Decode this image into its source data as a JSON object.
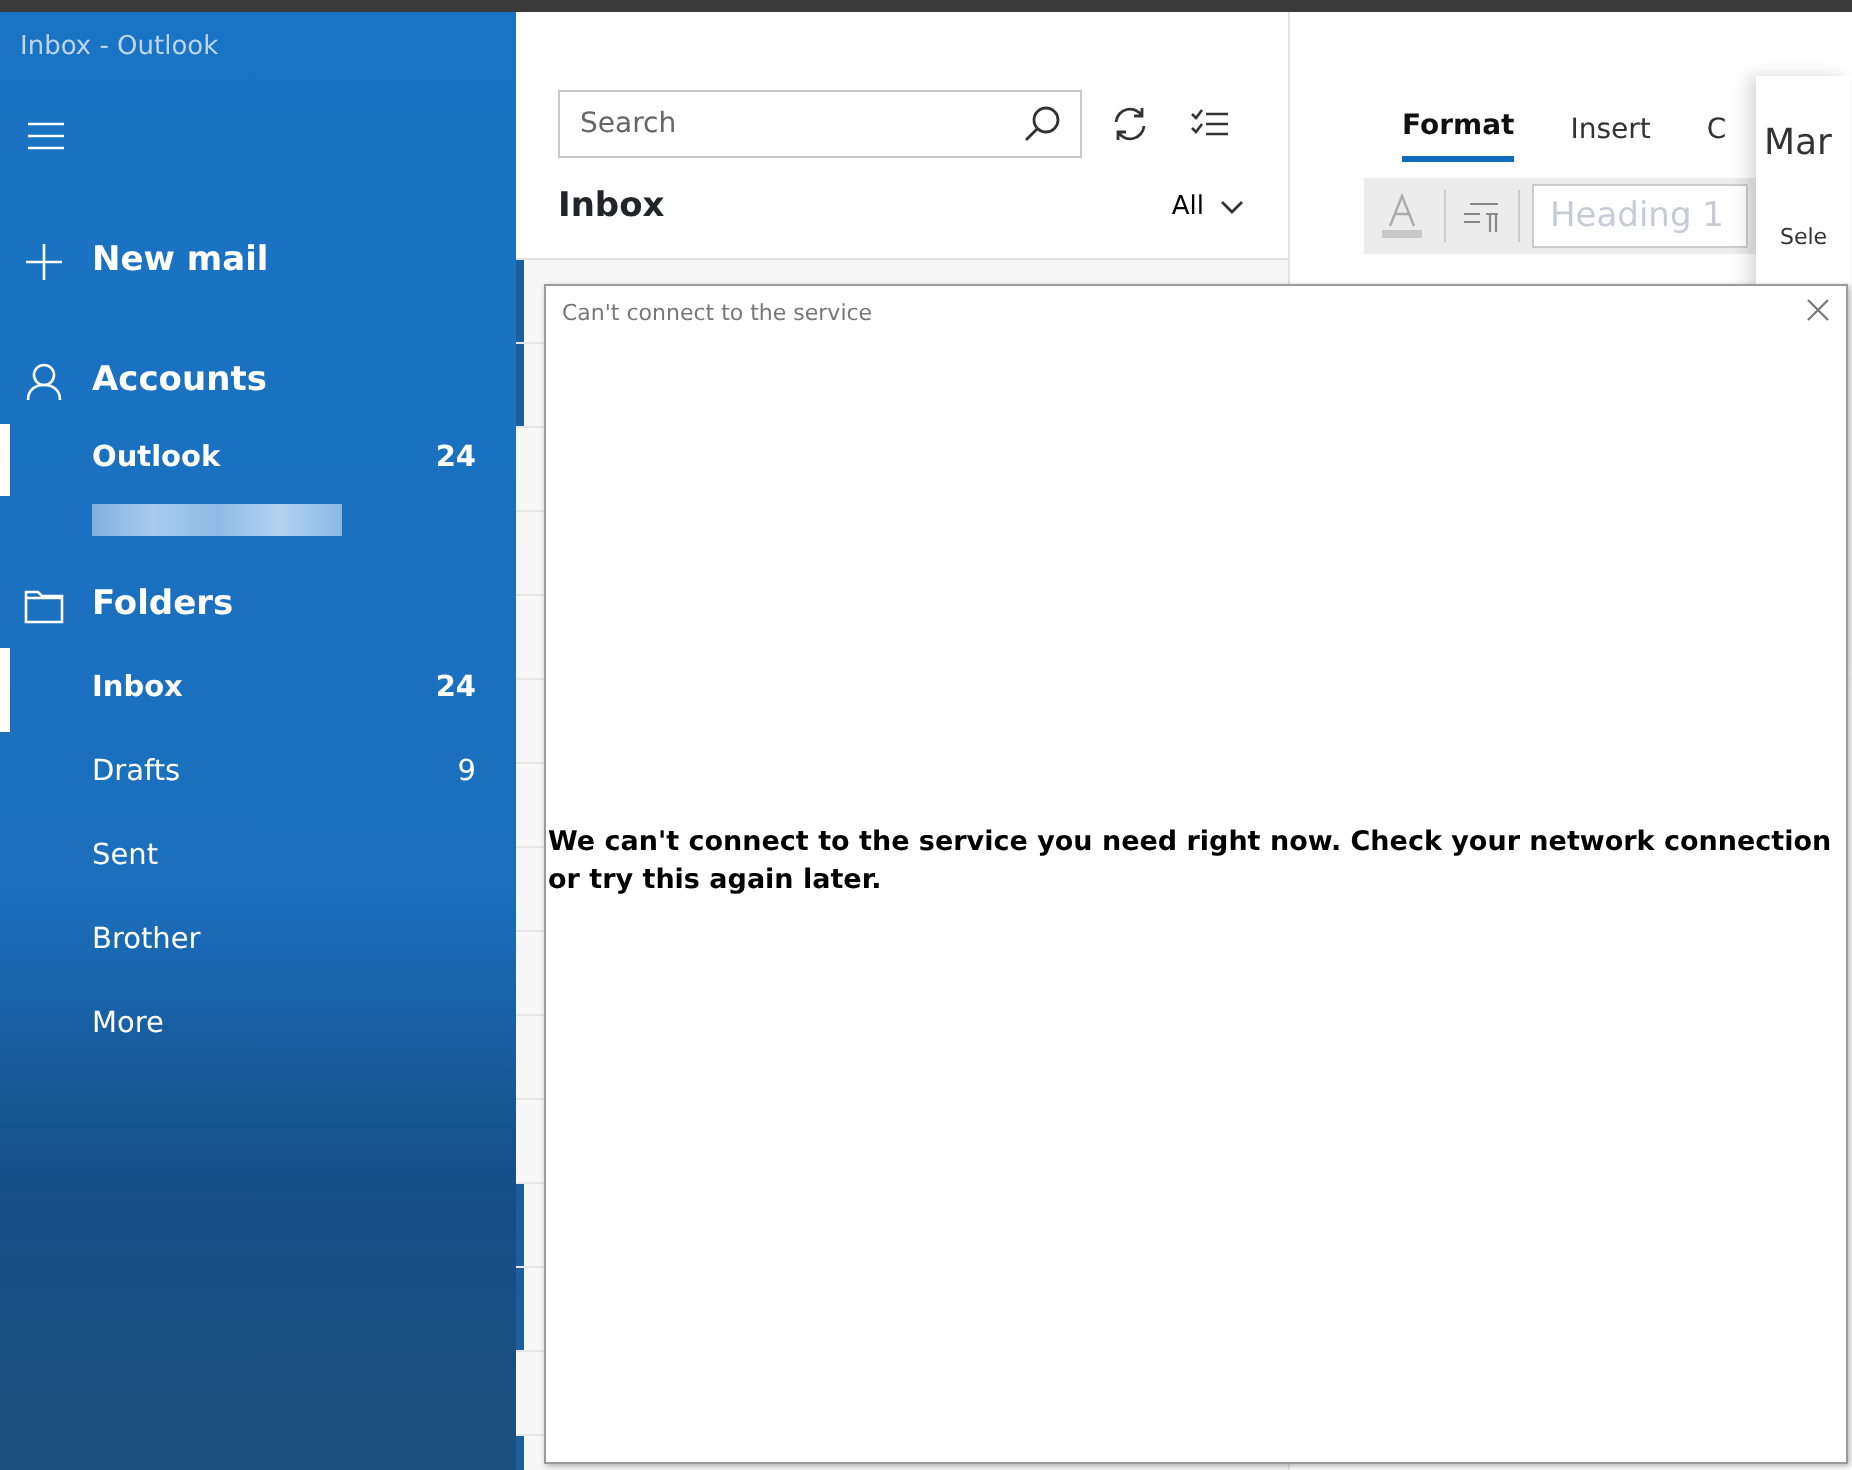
{
  "window": {
    "title": "Inbox - Outlook"
  },
  "sidebar": {
    "new_mail": "New mail",
    "accounts_heading": "Accounts",
    "accounts": [
      {
        "name": "Outlook",
        "count": "24",
        "selected": true
      }
    ],
    "folders_heading": "Folders",
    "folders": [
      {
        "name": "Inbox",
        "count": "24",
        "selected": true
      },
      {
        "name": "Drafts",
        "count": "9",
        "selected": false
      },
      {
        "name": "Sent",
        "selected": false
      },
      {
        "name": "Brother",
        "selected": false
      },
      {
        "name": "More",
        "selected": false
      }
    ]
  },
  "message_list": {
    "search": {
      "placeholder": "Search"
    },
    "heading": "Inbox",
    "filter": "All",
    "rows": [
      {
        "unread": true
      },
      {
        "unread": true
      },
      {
        "unread": false
      },
      {
        "unread": false
      },
      {
        "unread": false
      },
      {
        "unread": false
      },
      {
        "unread": false
      },
      {
        "unread": false
      },
      {
        "unread": false
      },
      {
        "unread": false
      },
      {
        "unread": false
      },
      {
        "unread": true
      },
      {
        "unread": true
      },
      {
        "unread": false
      },
      {
        "unread": true
      }
    ]
  },
  "reading_pane": {
    "tabs": [
      {
        "label": "Format",
        "selected": true
      },
      {
        "label": "Insert",
        "selected": false
      },
      {
        "label": "C",
        "selected": false
      }
    ],
    "style_field": {
      "placeholder": "Heading 1"
    }
  },
  "side_panel": {
    "title": "Mar",
    "text": "Sele"
  },
  "dialog": {
    "title": "Can't connect to the service",
    "message": "We can't connect to the service you need right now. Check your network connection or try this again later."
  }
}
